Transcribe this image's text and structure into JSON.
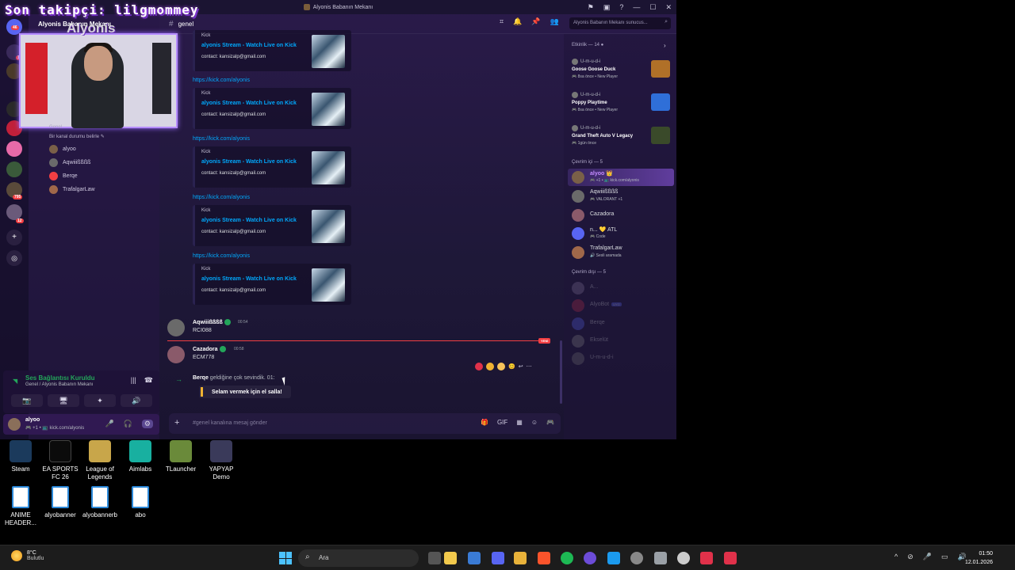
{
  "window": {
    "title": "Alyonis Babanın Mekanı",
    "controls": [
      "⚑",
      "▣",
      "?",
      "—",
      "☐",
      "✕"
    ]
  },
  "overlay": {
    "title": "Son takipçi: lilgmommey",
    "streamer_name": "Alyonis"
  },
  "server_rail": {
    "badges": [
      "46",
      "12",
      "795",
      "12"
    ]
  },
  "sidebar": {
    "server_name": "Alyonis Babanın Mekanı",
    "voice_channel_title": "Genel",
    "voice_channel_status": "Bir kanal durumu belirle ✎",
    "voice_members": [
      {
        "name": "alyoo",
        "color": "#7a6048"
      },
      {
        "name": "Aqwiiißßßß",
        "color": "#6a6a6a"
      },
      {
        "name": "Berqe",
        "color": "#f23f43"
      },
      {
        "name": "TrafalgarLaw",
        "color": "#a0684a"
      }
    ]
  },
  "voice_panel": {
    "title": "Ses Bağlantısı Kuruldu",
    "subtitle": "Genel / Alyonis Babanın Mekanı",
    "buttons": [
      "📷",
      "🖥",
      "✦",
      "🔊"
    ],
    "right_icons": [
      "|||",
      "☎"
    ]
  },
  "user_panel": {
    "username": "alyoo",
    "status": "🎮 +1 • 📺 kick.com/alyonis",
    "icons": [
      "🎤",
      "🎧",
      "⚙"
    ]
  },
  "channel": {
    "name": "genel",
    "header_icons": [
      "⌗",
      "🔔",
      "📌",
      "👥"
    ],
    "search_placeholder": "Alyonis Babanın Mekanı sunucus...",
    "composer_placeholder": "#genel kanalına mesaj gönder",
    "composer_icons": [
      "🎁",
      "GIF",
      "▦",
      "☺",
      "🎮"
    ]
  },
  "embeds": [
    {
      "provider": "Kick",
      "title": "alyonis Stream - Watch Live on Kick",
      "desc": "contact: kansizalp@gmail.com",
      "link": ""
    },
    {
      "provider": "Kick",
      "title": "alyonis Stream - Watch Live on Kick",
      "desc": "contact: kansizalp@gmail.com",
      "link": "https://kick.com/alyonis"
    },
    {
      "provider": "Kick",
      "title": "alyonis Stream - Watch Live on Kick",
      "desc": "contact: kansizalp@gmail.com",
      "link": "https://kick.com/alyonis"
    },
    {
      "provider": "Kick",
      "title": "alyonis Stream - Watch Live on Kick",
      "desc": "contact: kansizalp@gmail.com",
      "link": "https://kick.com/alyonis"
    },
    {
      "provider": "Kick",
      "title": "alyonis Stream - Watch Live on Kick",
      "desc": "contact: kansizalp@gmail.com",
      "link": "https://kick.com/alyonis"
    }
  ],
  "messages": [
    {
      "author": "Aqwiiißßßß",
      "time": "00:54",
      "text": "RCI088"
    },
    {
      "author": "Cazadora",
      "time": "00:58",
      "text": "ECM778"
    }
  ],
  "new_divider": "YENİ",
  "system_message": {
    "author": "Berqe",
    "text": "geldiğine çok sevindik.",
    "time": "01:",
    "wave_button": "Selam vermek için el salla!"
  },
  "reaction_bar": [
    "😊",
    "↩",
    "⋯"
  ],
  "activity": {
    "title": "Etkinlik — 14 ●",
    "items": [
      {
        "who": "U-m-u-d-i",
        "game": "Goose Goose Duck",
        "meta": "🎮 8sa önce • New Player",
        "art": "#b07028"
      },
      {
        "who": "U-m-u-d-i",
        "game": "Poppy Playtime",
        "meta": "🎮 8sa önce • New Player",
        "art": "#2f6fd8"
      },
      {
        "who": "U-m-u-d-i",
        "game": "Grand Theft Auto V Legacy",
        "meta": "🎮 1gün önce",
        "art": "#3a4a2a"
      }
    ]
  },
  "online": {
    "title": "Çevrim içi — 5",
    "members": [
      {
        "name": "alyoo 👑",
        "status": "🎮 +1 • 📺 kick.com/alyonis",
        "color": "#7a6048"
      },
      {
        "name": "Aqwiiißßßß",
        "status": "🎮 VALORANT +1",
        "color": "#6a6a6a"
      },
      {
        "name": "Cazadora",
        "status": "",
        "color": "#8a5a6a"
      },
      {
        "name": "n... 💛 ATL",
        "status": "🎮 Code",
        "color": "#5865f2"
      },
      {
        "name": "TrafalgarLaw",
        "status": "🔊 Sesli aramada",
        "color": "#a0684a"
      }
    ]
  },
  "offline": {
    "title": "Çevrim dışı — 5",
    "members": [
      {
        "name": "A...",
        "tag": "",
        "color": "#8a7aa0"
      },
      {
        "name": "AlyoBot",
        "tag": "UYG",
        "color": "#c0304a"
      },
      {
        "name": "Berqe",
        "tag": "",
        "color": "#5865f2"
      },
      {
        "name": "Ekselüt",
        "tag": "",
        "color": "#888"
      },
      {
        "name": "U-m-u-d-i",
        "tag": "",
        "color": "#777"
      }
    ]
  },
  "desktop": {
    "row1": [
      {
        "label": "Steam",
        "color": "#1b3a5c"
      },
      {
        "label": "EA SPORTS FC 26",
        "color": "#0b0b0b"
      },
      {
        "label": "League of Legends",
        "color": "#c8a64a"
      },
      {
        "label": "Aimlabs",
        "color": "#18b0a0"
      },
      {
        "label": "TLauncher",
        "color": "#6a8a3a"
      },
      {
        "label": "YAPYAP Demo",
        "color": "#3a3a5a"
      }
    ],
    "row2": [
      {
        "label": "ANIME HEADER..."
      },
      {
        "label": "alyobanner"
      },
      {
        "label": "alyobannerb"
      },
      {
        "label": "abo"
      }
    ]
  },
  "taskbar": {
    "temp": "8°C",
    "weather": "Bulutlu",
    "search": "Ara",
    "apps": [
      "#f2c94c",
      "#3a7bd5",
      "#e8b23a",
      "#5865f2",
      "#e88c1a",
      "#fb542b",
      "#1db954",
      "#6c4cd8",
      "#1b9aee",
      "#888888",
      "#9aa0a6",
      "#cccccc",
      "#e0314a",
      "#e0314a"
    ],
    "tray": [
      "^",
      "⊘",
      "🎤",
      "▭",
      "🔊"
    ],
    "time": "01:50",
    "date": "12.01.2026"
  }
}
